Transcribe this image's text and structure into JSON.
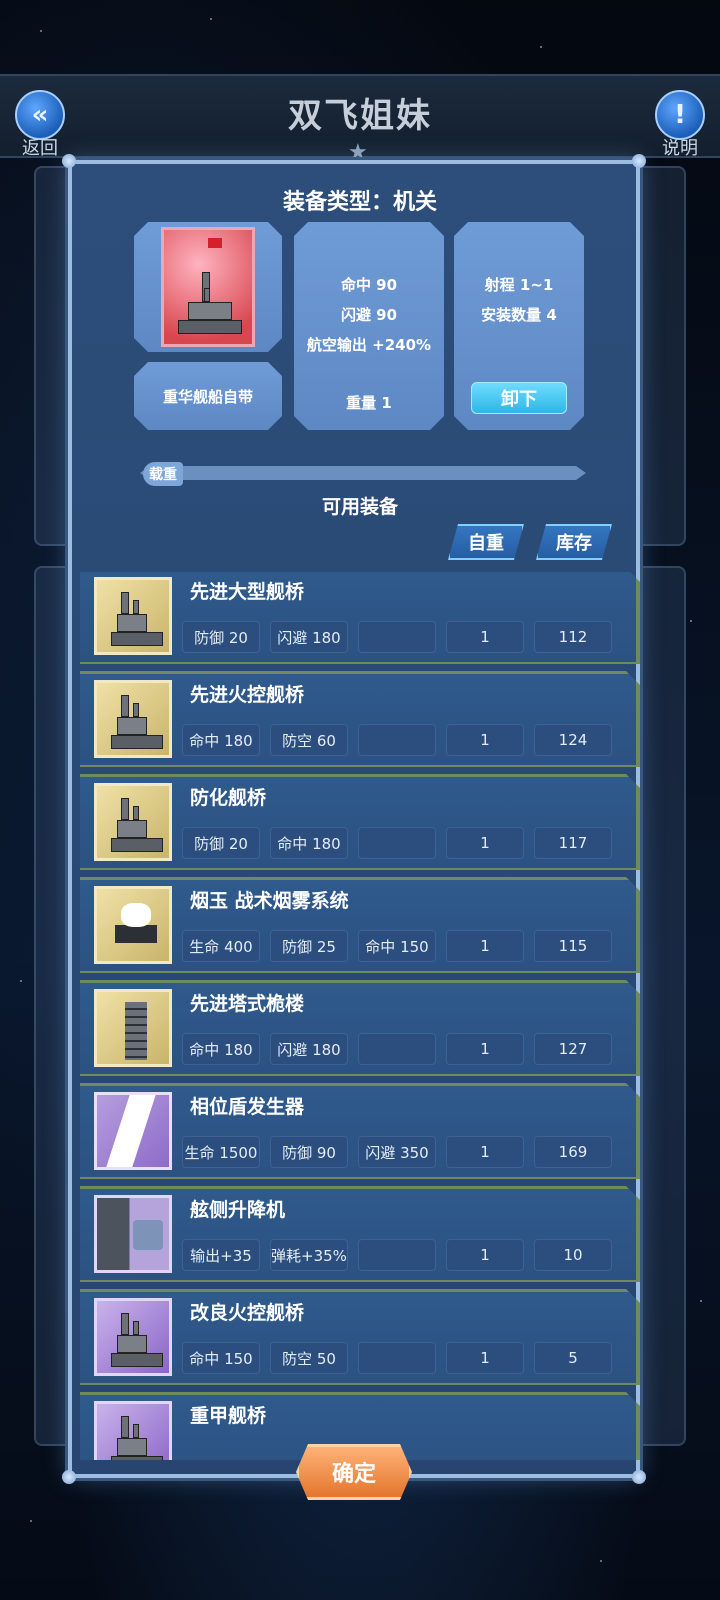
{
  "header": {
    "title": "双飞姐妹",
    "back_label": "返回",
    "help_label": "说明",
    "back_icon": "double-chevron-left-icon",
    "help_icon": "exclamation-icon"
  },
  "dialog": {
    "title": "装备类型：机关",
    "source_label": "重华舰船自带",
    "stats": [
      "命中 90",
      "闪避 90",
      "航空输出 +240%"
    ],
    "weight": "重量 1",
    "range": "射程 1~1",
    "install_count": "安装数量 4",
    "unload_label": "卸下",
    "load_label": "载重",
    "available_title": "可用装备",
    "sort_self_weight": "自重",
    "sort_stock": "库存",
    "confirm_label": "确定"
  },
  "items": [
    {
      "name": "先进大型舰桥",
      "thumb": "gold",
      "stats": [
        "防御 20",
        "闪避 180",
        ""
      ],
      "count": "1",
      "value": "112"
    },
    {
      "name": "先进火控舰桥",
      "thumb": "gold",
      "stats": [
        "命中 180",
        "防空 60",
        ""
      ],
      "count": "1",
      "value": "124"
    },
    {
      "name": "防化舰桥",
      "thumb": "gold",
      "stats": [
        "防御 20",
        "命中 180",
        ""
      ],
      "count": "1",
      "value": "117"
    },
    {
      "name": "烟玉 战术烟雾系统",
      "thumb": "gold",
      "stats": [
        "生命 400",
        "防御 25",
        "命中 150"
      ],
      "count": "1",
      "value": "115"
    },
    {
      "name": "先进塔式桅楼",
      "thumb": "gold",
      "stats": [
        "命中 180",
        "闪避 180",
        ""
      ],
      "count": "1",
      "value": "127"
    },
    {
      "name": "相位盾发生器",
      "thumb": "shield",
      "stats": [
        "生命 1500",
        "防御 90",
        "闪避 350"
      ],
      "count": "1",
      "value": "169"
    },
    {
      "name": "舷侧升降机",
      "thumb": "gray",
      "stats": [
        "输出+35",
        "弹耗+35%",
        ""
      ],
      "count": "1",
      "value": "10"
    },
    {
      "name": "改良火控舰桥",
      "thumb": "purple",
      "stats": [
        "命中 150",
        "防空 50",
        ""
      ],
      "count": "1",
      "value": "5"
    },
    {
      "name": "重甲舰桥",
      "thumb": "purple",
      "stats": [
        "",
        "",
        ""
      ],
      "count": "",
      "value": ""
    }
  ],
  "colors": {
    "dialog_bg": "#2d4d7a",
    "card_bg": "#6f9bd6",
    "unload_button": "#2fb6e6",
    "confirm_button": "#e4762e",
    "row_border": "#6f8b5e"
  }
}
